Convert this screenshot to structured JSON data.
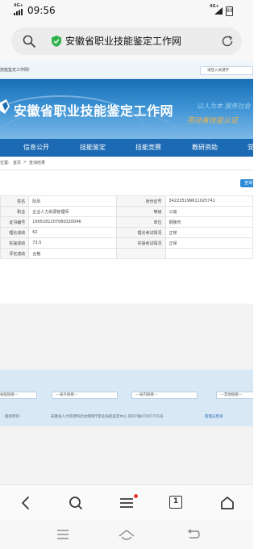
{
  "status_bar": {
    "signal_left": "4G+",
    "time": "09:56",
    "signal_right": "4G+",
    "battery": "89"
  },
  "address_bar": {
    "site_title": "安徽省职业技能鉴定工作网"
  },
  "site": {
    "welcome_text": "技能鉴定工作网!",
    "login_link": "请登入关键字",
    "banner_title": "安徽省职业技能鉴定工作网",
    "slogan_line1": "以人为本 服务社会",
    "slogan_line2": "劳动者技能认证",
    "nav_items": [
      "信息公开",
      "技能鉴定",
      "技能竞赛",
      "教研资助",
      "党"
    ],
    "breadcrumb": {
      "prefix": "位置:",
      "home": "首页",
      "separator": ">",
      "current": "查询结果"
    },
    "search_button": "查询",
    "results": [
      {
        "label": "姓名",
        "value": "阮凤",
        "label2": "身份证号",
        "value2": "342225199611025741"
      },
      {
        "label": "职业",
        "value": "企业人力资源管理师",
        "label2": "等级",
        "value2": "三级"
      },
      {
        "label": "证书编号",
        "value": "1905181207080320046",
        "label2": "单位",
        "value2": "铜陵市"
      },
      {
        "label": "理论成绩",
        "value": "62",
        "label2": "理论考试情况",
        "value2": "正常"
      },
      {
        "label": "实操成绩",
        "value": "73.5",
        "label2": "实操考试情况",
        "value2": "正常"
      },
      {
        "label": "评定成绩",
        "value": "合格",
        "label2": "",
        "value2": ""
      }
    ],
    "footer_links": [
      "---省级链接---",
      "---省外链接---",
      "---省内链接---",
      "---其他链接---"
    ],
    "copyright_label": "版权所有:",
    "copyright_text": "安徽省人力资源和社会保障厅职业技能鉴定中心 皖ICP备07007725号",
    "admin_login": "管理员登录"
  },
  "browser_toolbar": {
    "tab_count": "1"
  },
  "icons": {
    "back": "back-icon",
    "search": "search-icon",
    "menu": "menu-icon",
    "tabs": "tabs-icon",
    "home": "home-icon"
  }
}
